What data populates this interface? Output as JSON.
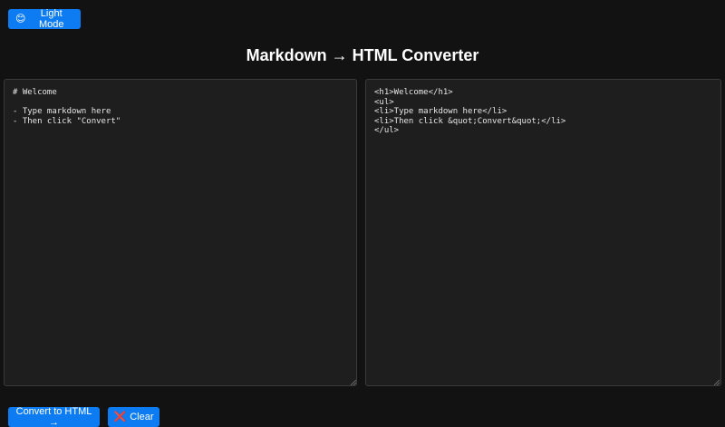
{
  "toolbar": {
    "theme_icon": "😊",
    "theme_label": "Light Mode"
  },
  "header": {
    "title": "Markdown → HTML Converter"
  },
  "editor": {
    "input_value": "# Welcome\n\n- Type markdown here\n- Then click \"Convert\"",
    "output_value": "<h1>Welcome</h1>\n<ul>\n<li>Type markdown here</li>\n<li>Then click &quot;Convert&quot;</li>\n</ul>"
  },
  "actions": {
    "convert_label": "Convert to HTML →",
    "clear_icon": "❌",
    "clear_label": "Clear"
  },
  "colors": {
    "background": "#121212",
    "pane_background": "#1e1e1e",
    "accent": "#0d7cf2"
  },
  "icons": {
    "theme": "smiley-face-icon",
    "clear": "red-x-icon",
    "resize": "resize-grip-icon"
  }
}
